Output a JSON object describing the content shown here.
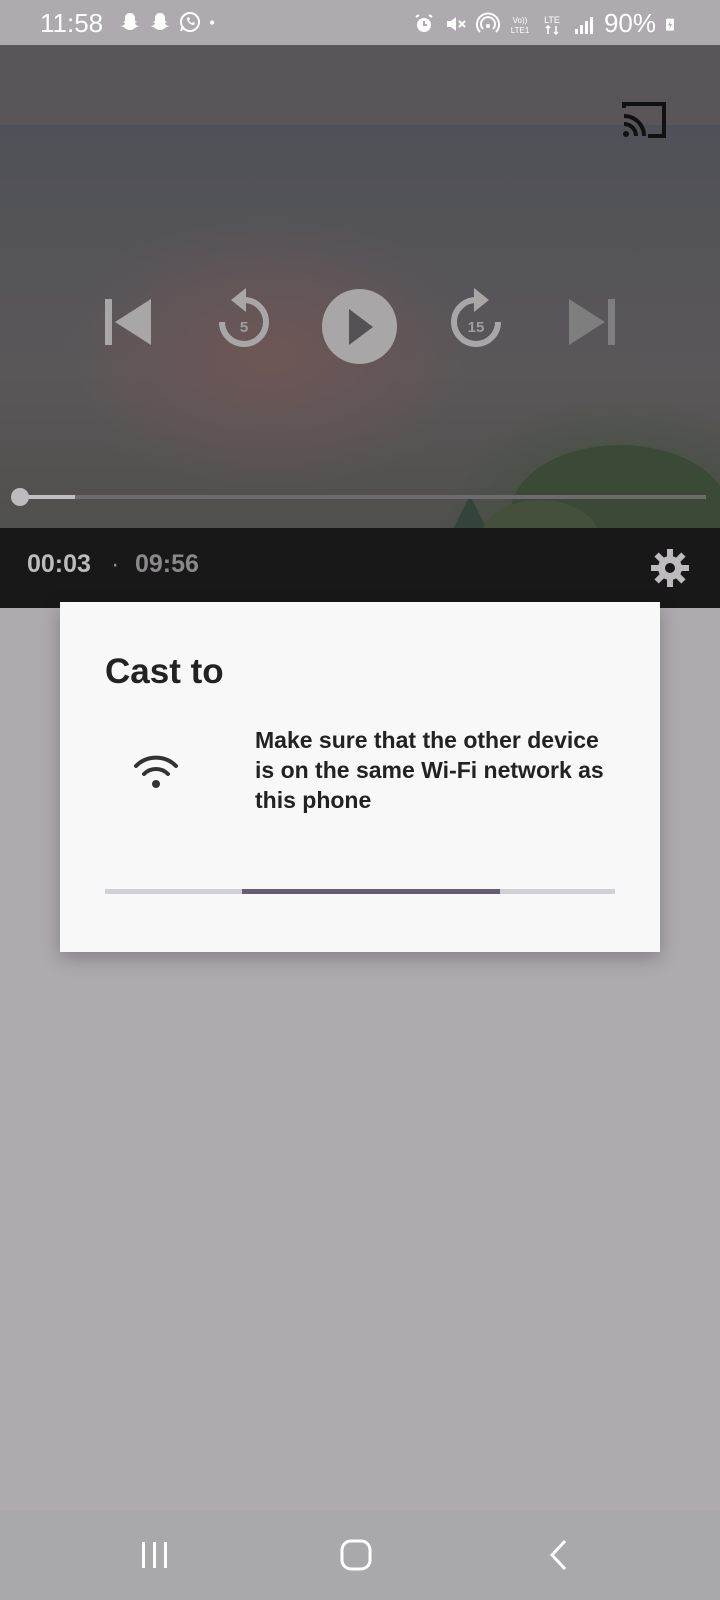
{
  "status_bar": {
    "time": "11:58",
    "battery": "90%",
    "left_icons": [
      "snapchat-icon",
      "snapchat-icon",
      "whatsapp-icon",
      "dot-icon"
    ],
    "right_icons": [
      "alarm-icon",
      "mute-icon",
      "hotspot-icon",
      "volte-icon",
      "lte-icon",
      "signal-icon",
      "battery-charging-icon"
    ]
  },
  "player": {
    "current_time": "00:03",
    "separator": "·",
    "duration": "09:56",
    "progress_fraction": 0.0051,
    "buffered_fraction": 0.085,
    "rewind_seconds": "5",
    "forward_seconds": "15"
  },
  "dialog": {
    "title": "Cast to",
    "message": "Make sure that the other device is on the same Wi-Fi network as this phone"
  },
  "colors": {
    "dialog_bg": "#f8f8f8",
    "progress_accent": "#655d73",
    "scrim": "#aeaaaf"
  }
}
